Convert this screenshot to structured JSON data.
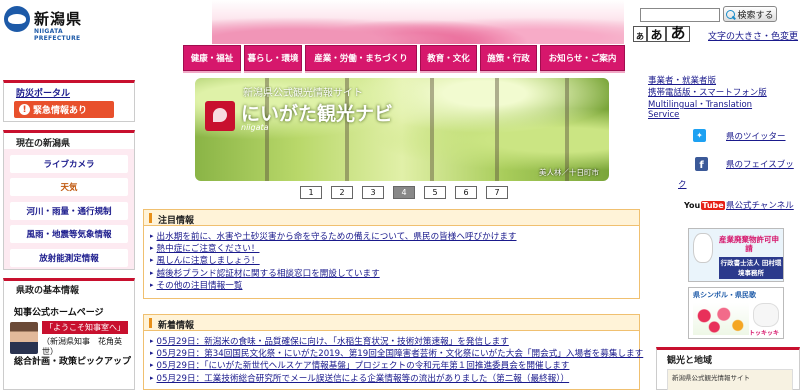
{
  "header": {
    "logo_jp": "新潟県",
    "logo_en": "NIIGATA PREFECTURE",
    "search_placeholder": "",
    "search_button": "検索する",
    "font_sizes": [
      "あ",
      "あ",
      "あ"
    ],
    "font_color_link": "文字の大きさ・色変更"
  },
  "nav": [
    "健康・福祉",
    "暮らし・環境",
    "産業・労働・まちづくり",
    "教育・文化",
    "施策・行政",
    "お知らせ・ご案内"
  ],
  "left": {
    "disaster_title": "防災ポータル",
    "emergency_button": "緊急情報あり",
    "current_title": "現在の新潟県",
    "current_items": [
      "ライブカメラ",
      "天気",
      "河川・雨量・通行規制",
      "風雨・地震等気象情報",
      "放射能測定情報"
    ],
    "pref_title": "県政の基本情報",
    "governor_title": "知事公式ホームページ",
    "governor_welcome": "「ようこそ知事室へ」",
    "governor_name": "（新潟県知事　花角英",
    "governor_sub": "世）",
    "plan_title": "総合計画・政策ピックアップ"
  },
  "banner": {
    "subtitle": "新潟県公式観光情報サイト",
    "title": "にいがた観光ナビ",
    "romaji": "niigata",
    "caption": "美人林／十日町市",
    "pages": [
      "1",
      "2",
      "3",
      "4",
      "5",
      "6",
      "7"
    ],
    "active_page": "4"
  },
  "notice": {
    "title": "注目情報",
    "items": [
      "出水期を前に、水害や土砂災害から命を守るための備えについて、県民の皆様へ呼びかけます",
      "熱中症にご注意ください！",
      "風しんに注意しましょう！",
      "越後杉ブランド認証材に関する相談窓口を開設しています",
      "その他の注目情報一覧"
    ]
  },
  "news": {
    "title": "新着情報",
    "items": [
      "05月29日：新潟米の食味・品質確保に向け、「水稲生育状況・技術対策速報」を発信します",
      "05月29日：第34回国民文化祭・にいがた2019、第19回全国障害者芸術・文化祭にいがた大会「開会式」入場者を募集します",
      "05月29日：「にいがた新世代ヘルスケア情報基盤」プロジェクトの令和元年第１回推進委員会を開催します",
      "05月29日：工業技術総合研究所でメール誤送信による企業情報等の流出がありました（第二報（最終報））"
    ]
  },
  "right": {
    "links": [
      "事業者・就業者版",
      "携帯電話版・スマートフォン版",
      "Multilingual・Translation",
      "Service"
    ],
    "twitter": "県のツイッター",
    "facebook": "県のフェイスブッ",
    "facebook2": "ク",
    "youtube_you": "You",
    "youtube_tube": "Tube",
    "youtube": "県公式チャンネル",
    "ad_title": "産業廃棄物許可申請",
    "ad_sub": "行政書士法人 田村環境事務所",
    "symbol_title": "県シンボル・県民歌",
    "symbol_name": "トッキッキ",
    "tourism_title": "観光と地域",
    "tourism_banner": "新潟県公式観光情報サイト"
  },
  "colors": {
    "nav": "#d6176c",
    "accent_red": "#c8102e",
    "link": "#1a1a8c",
    "panel_border": "#f0c070"
  }
}
